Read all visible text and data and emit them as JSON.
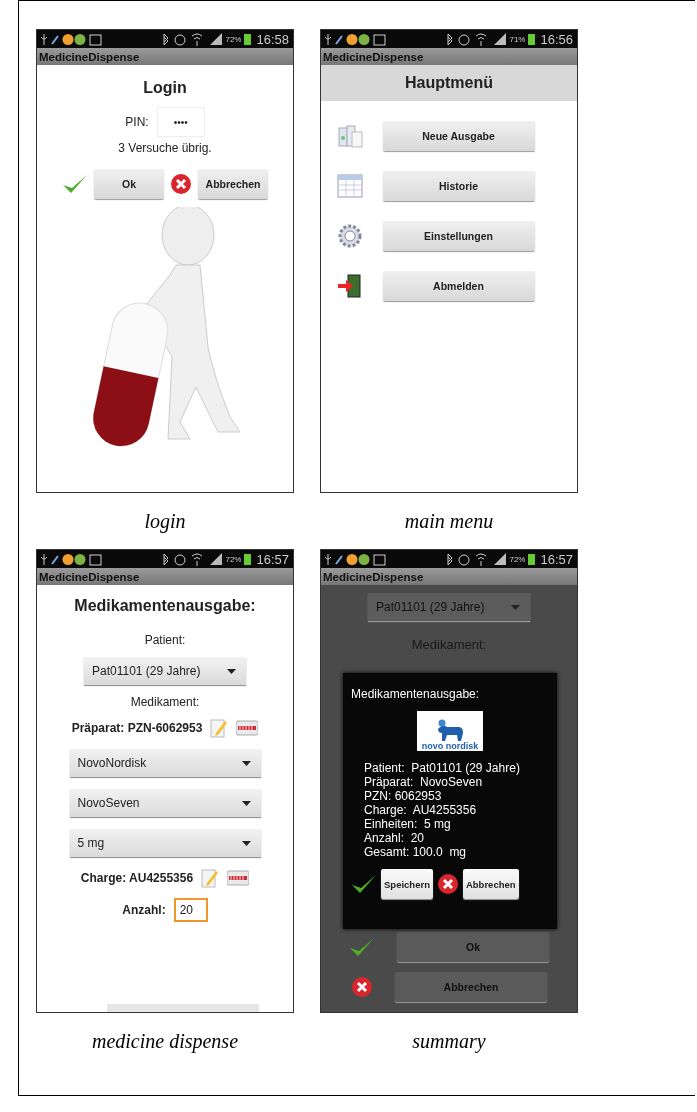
{
  "screens": [
    {
      "kind": "login",
      "caption": "login",
      "status": {
        "battery": "72%",
        "time": "16:58"
      },
      "app_title": "MedicineDispense",
      "title": "Login",
      "pin_label": "PIN:",
      "pin_value": "••••",
      "attempts": "3 Versuche übrig.",
      "buttons": [
        "Ok",
        "Abbrechen"
      ]
    },
    {
      "kind": "menu",
      "caption": "main menu",
      "status": {
        "battery": "71%",
        "time": "16:56"
      },
      "app_title": "MedicineDispense",
      "title": "Hauptmenü",
      "items": [
        "Neue Ausgabe",
        "Historie",
        "Einstellungen",
        "Abmelden"
      ]
    },
    {
      "kind": "dispense",
      "caption": "medicine dispense",
      "status": {
        "battery": "72%",
        "time": "16:57"
      },
      "app_title": "MedicineDispense",
      "title": "Medikamentenausgabe:",
      "patient_label": "Patient:",
      "patient": "Pat01101 (29 Jahre)",
      "medication_label": "Medikament:",
      "preparation": "Präparat: PZN-6062953",
      "dropdowns": [
        "NovoNordisk",
        "NovoSeven",
        "5 mg"
      ],
      "batch": "Charge: AU4255356",
      "count_label": "Anzahl:",
      "count_value": "20"
    },
    {
      "kind": "summary",
      "caption": "summary",
      "status": {
        "battery": "72%",
        "time": "16:57"
      },
      "app_title": "MedicineDispense",
      "patient": "Pat01101 (29 Jahre)",
      "medication_label": "Medikament:",
      "buttons": [
        "Ok",
        "Abbrechen"
      ],
      "dialog": {
        "title": "Medikamentenausgabe:",
        "logo_text": "novo nordisk",
        "lines": [
          "Patient:  Pat01101 (29 Jahre)",
          "Präparat:  NovoSeven",
          "PZN: 6062953",
          "Charge:  AU4255356",
          "Einheiten:  5 mg",
          "Anzahl:  20",
          "Gesamt: 100.0  mg"
        ],
        "buttons": [
          "Speichern",
          "Abbrechen"
        ]
      }
    }
  ]
}
